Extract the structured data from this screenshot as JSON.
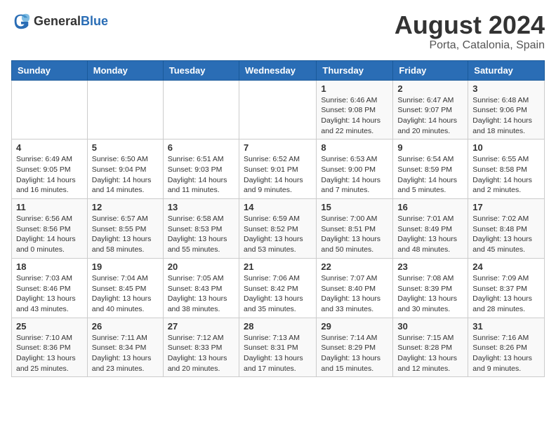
{
  "logo": {
    "general": "General",
    "blue": "Blue"
  },
  "header": {
    "month_year": "August 2024",
    "location": "Porta, Catalonia, Spain"
  },
  "weekdays": [
    "Sunday",
    "Monday",
    "Tuesday",
    "Wednesday",
    "Thursday",
    "Friday",
    "Saturday"
  ],
  "weeks": [
    [
      {
        "day": "",
        "sunrise": "",
        "sunset": "",
        "daylight": ""
      },
      {
        "day": "",
        "sunrise": "",
        "sunset": "",
        "daylight": ""
      },
      {
        "day": "",
        "sunrise": "",
        "sunset": "",
        "daylight": ""
      },
      {
        "day": "",
        "sunrise": "",
        "sunset": "",
        "daylight": ""
      },
      {
        "day": "1",
        "sunrise": "Sunrise: 6:46 AM",
        "sunset": "Sunset: 9:08 PM",
        "daylight": "Daylight: 14 hours and 22 minutes."
      },
      {
        "day": "2",
        "sunrise": "Sunrise: 6:47 AM",
        "sunset": "Sunset: 9:07 PM",
        "daylight": "Daylight: 14 hours and 20 minutes."
      },
      {
        "day": "3",
        "sunrise": "Sunrise: 6:48 AM",
        "sunset": "Sunset: 9:06 PM",
        "daylight": "Daylight: 14 hours and 18 minutes."
      }
    ],
    [
      {
        "day": "4",
        "sunrise": "Sunrise: 6:49 AM",
        "sunset": "Sunset: 9:05 PM",
        "daylight": "Daylight: 14 hours and 16 minutes."
      },
      {
        "day": "5",
        "sunrise": "Sunrise: 6:50 AM",
        "sunset": "Sunset: 9:04 PM",
        "daylight": "Daylight: 14 hours and 14 minutes."
      },
      {
        "day": "6",
        "sunrise": "Sunrise: 6:51 AM",
        "sunset": "Sunset: 9:03 PM",
        "daylight": "Daylight: 14 hours and 11 minutes."
      },
      {
        "day": "7",
        "sunrise": "Sunrise: 6:52 AM",
        "sunset": "Sunset: 9:01 PM",
        "daylight": "Daylight: 14 hours and 9 minutes."
      },
      {
        "day": "8",
        "sunrise": "Sunrise: 6:53 AM",
        "sunset": "Sunset: 9:00 PM",
        "daylight": "Daylight: 14 hours and 7 minutes."
      },
      {
        "day": "9",
        "sunrise": "Sunrise: 6:54 AM",
        "sunset": "Sunset: 8:59 PM",
        "daylight": "Daylight: 14 hours and 5 minutes."
      },
      {
        "day": "10",
        "sunrise": "Sunrise: 6:55 AM",
        "sunset": "Sunset: 8:58 PM",
        "daylight": "Daylight: 14 hours and 2 minutes."
      }
    ],
    [
      {
        "day": "11",
        "sunrise": "Sunrise: 6:56 AM",
        "sunset": "Sunset: 8:56 PM",
        "daylight": "Daylight: 14 hours and 0 minutes."
      },
      {
        "day": "12",
        "sunrise": "Sunrise: 6:57 AM",
        "sunset": "Sunset: 8:55 PM",
        "daylight": "Daylight: 13 hours and 58 minutes."
      },
      {
        "day": "13",
        "sunrise": "Sunrise: 6:58 AM",
        "sunset": "Sunset: 8:53 PM",
        "daylight": "Daylight: 13 hours and 55 minutes."
      },
      {
        "day": "14",
        "sunrise": "Sunrise: 6:59 AM",
        "sunset": "Sunset: 8:52 PM",
        "daylight": "Daylight: 13 hours and 53 minutes."
      },
      {
        "day": "15",
        "sunrise": "Sunrise: 7:00 AM",
        "sunset": "Sunset: 8:51 PM",
        "daylight": "Daylight: 13 hours and 50 minutes."
      },
      {
        "day": "16",
        "sunrise": "Sunrise: 7:01 AM",
        "sunset": "Sunset: 8:49 PM",
        "daylight": "Daylight: 13 hours and 48 minutes."
      },
      {
        "day": "17",
        "sunrise": "Sunrise: 7:02 AM",
        "sunset": "Sunset: 8:48 PM",
        "daylight": "Daylight: 13 hours and 45 minutes."
      }
    ],
    [
      {
        "day": "18",
        "sunrise": "Sunrise: 7:03 AM",
        "sunset": "Sunset: 8:46 PM",
        "daylight": "Daylight: 13 hours and 43 minutes."
      },
      {
        "day": "19",
        "sunrise": "Sunrise: 7:04 AM",
        "sunset": "Sunset: 8:45 PM",
        "daylight": "Daylight: 13 hours and 40 minutes."
      },
      {
        "day": "20",
        "sunrise": "Sunrise: 7:05 AM",
        "sunset": "Sunset: 8:43 PM",
        "daylight": "Daylight: 13 hours and 38 minutes."
      },
      {
        "day": "21",
        "sunrise": "Sunrise: 7:06 AM",
        "sunset": "Sunset: 8:42 PM",
        "daylight": "Daylight: 13 hours and 35 minutes."
      },
      {
        "day": "22",
        "sunrise": "Sunrise: 7:07 AM",
        "sunset": "Sunset: 8:40 PM",
        "daylight": "Daylight: 13 hours and 33 minutes."
      },
      {
        "day": "23",
        "sunrise": "Sunrise: 7:08 AM",
        "sunset": "Sunset: 8:39 PM",
        "daylight": "Daylight: 13 hours and 30 minutes."
      },
      {
        "day": "24",
        "sunrise": "Sunrise: 7:09 AM",
        "sunset": "Sunset: 8:37 PM",
        "daylight": "Daylight: 13 hours and 28 minutes."
      }
    ],
    [
      {
        "day": "25",
        "sunrise": "Sunrise: 7:10 AM",
        "sunset": "Sunset: 8:36 PM",
        "daylight": "Daylight: 13 hours and 25 minutes."
      },
      {
        "day": "26",
        "sunrise": "Sunrise: 7:11 AM",
        "sunset": "Sunset: 8:34 PM",
        "daylight": "Daylight: 13 hours and 23 minutes."
      },
      {
        "day": "27",
        "sunrise": "Sunrise: 7:12 AM",
        "sunset": "Sunset: 8:33 PM",
        "daylight": "Daylight: 13 hours and 20 minutes."
      },
      {
        "day": "28",
        "sunrise": "Sunrise: 7:13 AM",
        "sunset": "Sunset: 8:31 PM",
        "daylight": "Daylight: 13 hours and 17 minutes."
      },
      {
        "day": "29",
        "sunrise": "Sunrise: 7:14 AM",
        "sunset": "Sunset: 8:29 PM",
        "daylight": "Daylight: 13 hours and 15 minutes."
      },
      {
        "day": "30",
        "sunrise": "Sunrise: 7:15 AM",
        "sunset": "Sunset: 8:28 PM",
        "daylight": "Daylight: 13 hours and 12 minutes."
      },
      {
        "day": "31",
        "sunrise": "Sunrise: 7:16 AM",
        "sunset": "Sunset: 8:26 PM",
        "daylight": "Daylight: 13 hours and 9 minutes."
      }
    ]
  ]
}
